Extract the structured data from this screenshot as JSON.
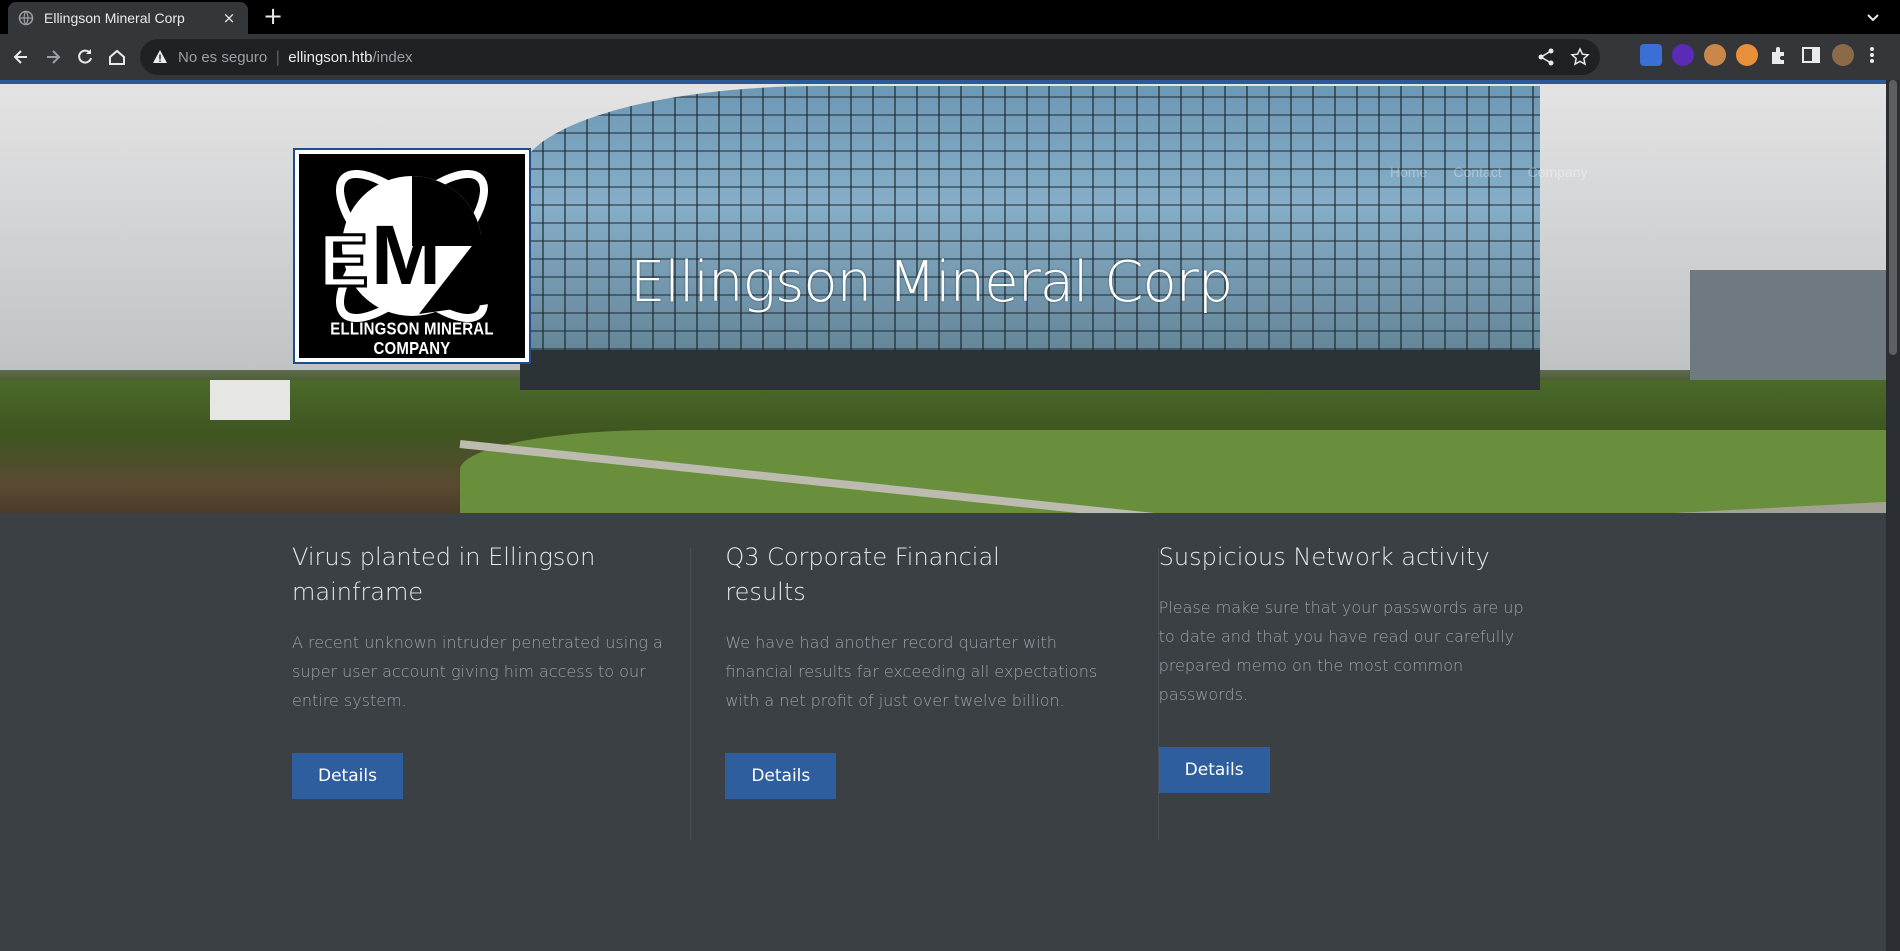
{
  "browser": {
    "tab_title": "Ellingson Mineral Corp",
    "new_tab": "+",
    "close": "×",
    "security_label": "No es seguro",
    "url_host": "ellingson.htb",
    "url_path": "/index"
  },
  "hero": {
    "logo_caption": "ELLINGSON MINERAL COMPANY",
    "logo_letters": "EMC",
    "title": "Ellingson Mineral Corp",
    "nav": [
      "Home",
      "Contact",
      "Company"
    ]
  },
  "articles": [
    {
      "title": "Virus planted in Ellingson mainframe",
      "body": "A recent unknown intruder penetrated using a super user account giving him access to our entire system.",
      "button": "Details"
    },
    {
      "title": "Q3 Corporate Financial results",
      "body": "We have had another record quarter with financial results far exceeding all expectations with a net profit of just over twelve billion.",
      "button": "Details"
    },
    {
      "title": "Suspicious Network activity",
      "body": "Please make sure that your passwords are up to date and that you have read our carefully prepared memo on the most common passwords.",
      "button": "Details"
    }
  ],
  "colors": {
    "page_bg": "#3b4045",
    "button_bg": "#2f5e9e",
    "heading": "#e6e8ea",
    "body_text": "#9ca3a8"
  }
}
